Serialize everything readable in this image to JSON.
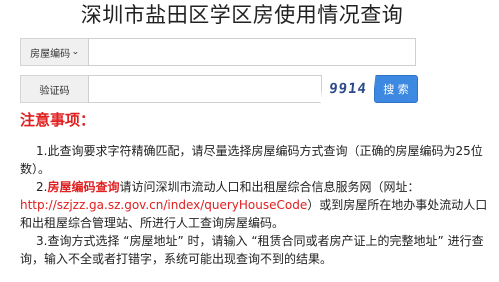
{
  "title": "深圳市盐田区学区房使用情况查询",
  "search_form": {
    "house_type_select": {
      "selected": "房屋编码",
      "icon": "chevron-down-icon"
    },
    "house_code_input": {
      "value": "",
      "placeholder": ""
    },
    "captcha_label": "验证码",
    "captcha_input": {
      "value": "",
      "placeholder": ""
    },
    "captcha_code": "9914",
    "search_button_label": "搜 索"
  },
  "notice": {
    "heading": "注意事项：",
    "item1": "1.此查询要求字符精确匹配，请尽量选择房屋编码方式查询（正确的房屋编码为25位数）。",
    "item2": {
      "prefix": "2.",
      "highlight": "房屋编码查询",
      "text_before_link": "请访问深圳市流动人口和出租屋综合信息服务网（网址：",
      "link": "http://szjzz.ga.sz.gov.cn/index/queryHouseCode",
      "text_after_link": "）或到房屋所在地办事处流动人口和出租屋综合管理站、所进行人工查询房屋编码。"
    },
    "item3": "3.查询方式选择 “房屋地址” 时，请输入 “租赁合同或者房产证上的完整地址” 进行查询，输入不全或者打错字，系统可能出现查询不到的结果。"
  }
}
